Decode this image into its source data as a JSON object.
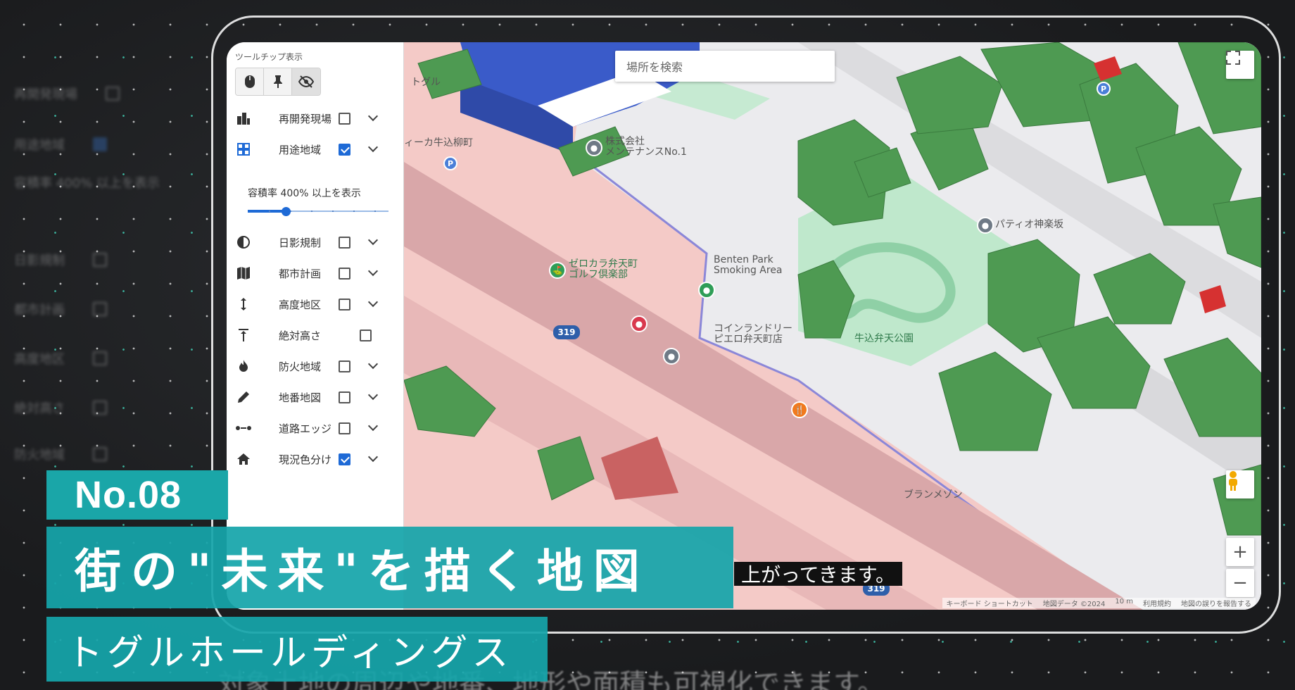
{
  "sidebar": {
    "tooltip_title": "ツールチップ表示",
    "tools": [
      {
        "icon": "mouse-icon"
      },
      {
        "icon": "pin-icon"
      },
      {
        "icon": "eye-off-icon"
      }
    ],
    "layers": [
      {
        "label": "再開発現場",
        "icon": "buildings-icon",
        "checked": false,
        "expandable": true
      },
      {
        "label": "用途地域",
        "icon": "grid-icon",
        "checked": true,
        "expandable": true
      },
      {
        "label": "日影規制",
        "icon": "half-circle-icon",
        "checked": false,
        "expandable": true
      },
      {
        "label": "都市計画",
        "icon": "map-icon",
        "checked": false,
        "expandable": true
      },
      {
        "label": "高度地区",
        "icon": "height-arrow-icon",
        "checked": false,
        "expandable": true
      },
      {
        "label": "絶対高さ",
        "icon": "absolute-height-icon",
        "checked": false,
        "expandable": false
      },
      {
        "label": "防火地域",
        "icon": "fire-icon",
        "checked": false,
        "expandable": true
      },
      {
        "label": "地番地図",
        "icon": "pencil-icon",
        "checked": false,
        "expandable": true
      },
      {
        "label": "道路エッジ",
        "icon": "dotted-line-icon",
        "checked": false,
        "expandable": true
      },
      {
        "label": "現況色分け",
        "icon": "home-icon",
        "checked": true,
        "expandable": true
      }
    ],
    "floor_area_label": "容積率 400% 以上を表示",
    "floor_area_slider_fraction": 0.27
  },
  "map": {
    "search_placeholder": "場所を検索",
    "labels": {
      "company": "株式会社\nメンテナンスNo.1",
      "golf": "ゼロカラ弁天町\nゴルフ倶楽部",
      "smoking": "Benten Park\nSmoking Area",
      "laundry": "コインランドリー\nピエロ弁天町店",
      "park": "牛込弁天公園",
      "patio": "パティオ神楽坂",
      "shop_left": "ィーカ牛込柳町",
      "brand": "ブランメゾン",
      "togle": "トグル",
      "route": "319",
      "route2": "319"
    },
    "attribution": [
      "キーボード ショートカット",
      "地図データ ©2024",
      "10 m",
      "利用規約",
      "地図の誤りを報告する"
    ],
    "zoom_in": "+",
    "zoom_out": "−"
  },
  "caption": "上がってきます。",
  "caption_bottom": "対象土地の周辺や地番、地形や面積も可視化できます。",
  "overlay": {
    "number": "No.08",
    "title": "街の\"未来\"を描く地図",
    "company": "トグルホールディングス"
  },
  "colors": {
    "accent": "#1aa6a8",
    "zone_pink": "#f4c9c6",
    "park_green": "#bfe8cc",
    "building_green": "#4e9a52",
    "building_blue": "#3a5bc9"
  }
}
